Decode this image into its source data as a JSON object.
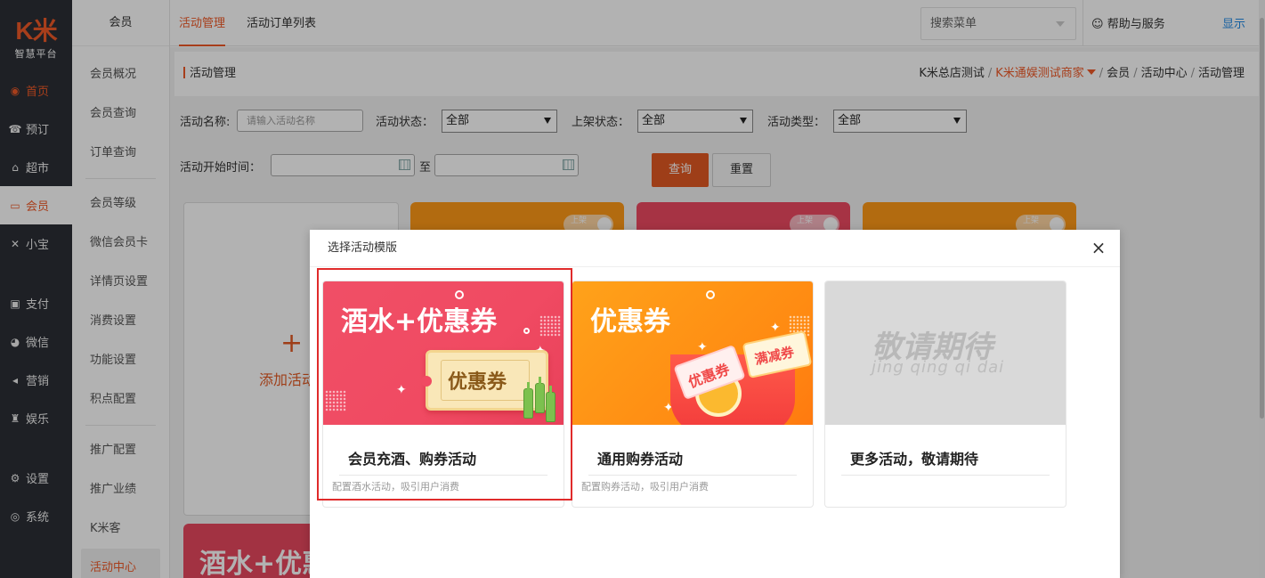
{
  "logo": {
    "brand": "K米",
    "subtitle": "智慧平台"
  },
  "leftnav": [
    {
      "icon": "dashboard-icon",
      "glyph": "◉",
      "label": "首页"
    },
    {
      "icon": "reserve-icon",
      "glyph": "☎",
      "label": "预订"
    },
    {
      "icon": "basket-icon",
      "glyph": "⌂",
      "label": "超市"
    },
    {
      "icon": "card-icon",
      "glyph": "▭",
      "label": "会员"
    },
    {
      "icon": "xiaobao-icon",
      "glyph": "✕",
      "label": "小宝"
    },
    {
      "icon": "pay-icon",
      "glyph": "▣",
      "label": "支付"
    },
    {
      "icon": "wechat-icon",
      "glyph": "◕",
      "label": "微信"
    },
    {
      "icon": "megaphone-icon",
      "glyph": "◂",
      "label": "营销"
    },
    {
      "icon": "entertain-icon",
      "glyph": "♜",
      "label": "娱乐"
    },
    {
      "icon": "settings-icon",
      "glyph": "⚙",
      "label": "设置"
    },
    {
      "icon": "system-icon",
      "glyph": "◎",
      "label": "系统"
    }
  ],
  "subnav": {
    "head": "会员",
    "items": [
      "会员概况",
      "会员查询",
      "订单查询",
      "会员等级",
      "微信会员卡",
      "详情页设置",
      "消费设置",
      "功能设置",
      "积点配置",
      "推广配置",
      "推广业绩",
      "K米客",
      "活动中心"
    ]
  },
  "topbar": {
    "tabs": [
      "活动管理",
      "活动订单列表"
    ],
    "search_menu": "搜索菜单",
    "help": "帮助与服务",
    "show": "显示"
  },
  "page": {
    "title": "活动管理",
    "breadcrumbs": [
      "K米总店测试",
      "K米通娱测试商家",
      "会员",
      "活动中心",
      "活动管理"
    ]
  },
  "filters": {
    "name_label": "活动名称:",
    "name_placeholder": "请输入活动名称",
    "status_label": "活动状态：",
    "status_value": "全部",
    "shelf_label": "上架状态：",
    "shelf_value": "全部",
    "type_label": "活动类型：",
    "type_value": "全部",
    "start_label": "活动开始时间：",
    "to_label": "至",
    "query": "查询",
    "reset": "重置"
  },
  "background": {
    "add_label": "添加活动",
    "toggle_label": "上架",
    "card_banner_text": "酒水+优惠券"
  },
  "modal": {
    "title": "选择活动模版",
    "templates": [
      {
        "banner_title": "酒水+优惠券",
        "ticket": "优惠券",
        "title": "会员充酒、购券活动",
        "desc": "配置酒水活动，吸引用户消费",
        "selected": true
      },
      {
        "banner_title": "优惠券",
        "coupon_a": "优惠券",
        "coupon_b": "满减券",
        "title": "通用购券活动",
        "desc": "配置购券活动，吸引用户消费",
        "selected": false
      },
      {
        "banner_title": "敬请期待",
        "banner_sub": "jing qing qi dai",
        "title": "更多活动，敬请期待",
        "desc": "",
        "selected": false
      }
    ]
  },
  "colors": {
    "accent": "#f05a28",
    "link": "#1e88e5",
    "selected_border": "#e02b2b"
  }
}
